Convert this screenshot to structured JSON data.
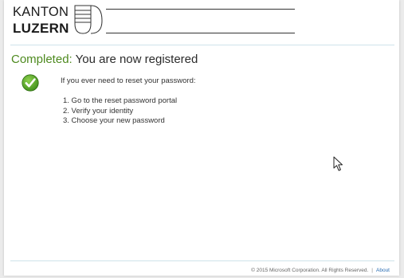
{
  "logo": {
    "line1": "KANTON",
    "line2": "LUZERN"
  },
  "heading": {
    "status": "Completed:",
    "message": "You are now registered"
  },
  "icons": {
    "status": "check-circle-icon",
    "cursor": "mouse-pointer-icon"
  },
  "content": {
    "intro": "If you ever need to reset your password:",
    "steps": [
      "1. Go to the reset password portal",
      "2. Verify your identity",
      "3. Choose your new password"
    ]
  },
  "footer": {
    "copyright": "© 2015 Microsoft Corporation. All Rights Reserved.",
    "separator": "|",
    "about": "About"
  },
  "colors": {
    "success": "#4e8a1f",
    "accent_rule": "#cfe3ea",
    "link": "#2a6db3"
  }
}
